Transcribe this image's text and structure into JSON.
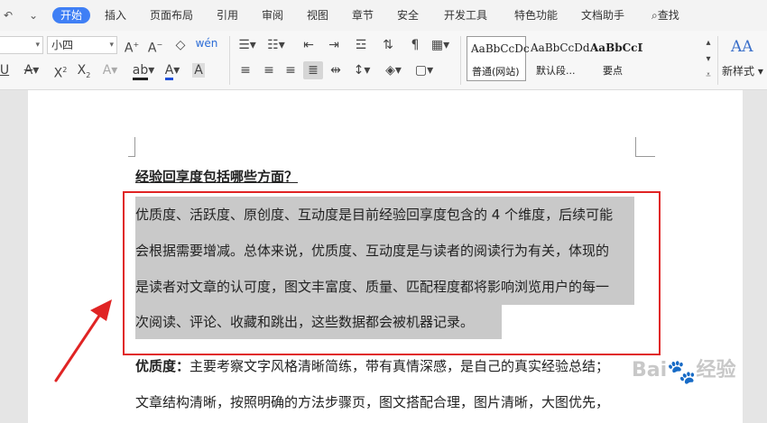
{
  "menubar": {
    "tabs": [
      "开始",
      "插入",
      "页面布局",
      "引用",
      "审阅",
      "视图",
      "章节",
      "安全",
      "开发工具",
      "特色功能",
      "文档助手"
    ],
    "search_label": "查找"
  },
  "ribbon": {
    "font_size_value": "小四",
    "line1": {
      "grow": "A⁺",
      "shrink": "A⁻",
      "clear": "◇",
      "pinyin": "wén"
    },
    "styles": [
      {
        "sample": "AaBbCcDc",
        "name": "普通(网站)"
      },
      {
        "sample": "AaBbCcDd",
        "name": "默认段..."
      },
      {
        "sample": "AaBbCcDc",
        "name": "要点"
      }
    ],
    "new_style_label": "新样式",
    "new_style_icon_text": "AA"
  },
  "document": {
    "heading": "经验回享度包括哪些方面？",
    "selected_lines": [
      "优质度、活跃度、原创度、互动度是目前经验回享度包含的 4 个维度，后续可能",
      "会根据需要增减。总体来说，优质度、互动度是与读者的阅读行为有关，体现的",
      "是读者对文章的认可度，图文丰富度、质量、匹配程度都将影响浏览用户的每一",
      "次阅读、评论、收藏和跳出，这些数据都会被机器记录。"
    ],
    "para2_bold": "优质度：",
    "para2_rest": "主要考察文字风格清晰简练，带有真情深感，是自己的真实经验总结；",
    "para3": "文章结构清晰，按照明确的方法步骤页，图文搭配合理，图片清晰，大图优先，"
  },
  "watermark": {
    "text": "经验",
    "prefix": "Bai",
    "paw": "🐾"
  },
  "colors": {
    "accent": "#3f7ff5",
    "annotation": "#e02424",
    "selection": "#c9c9c9"
  }
}
